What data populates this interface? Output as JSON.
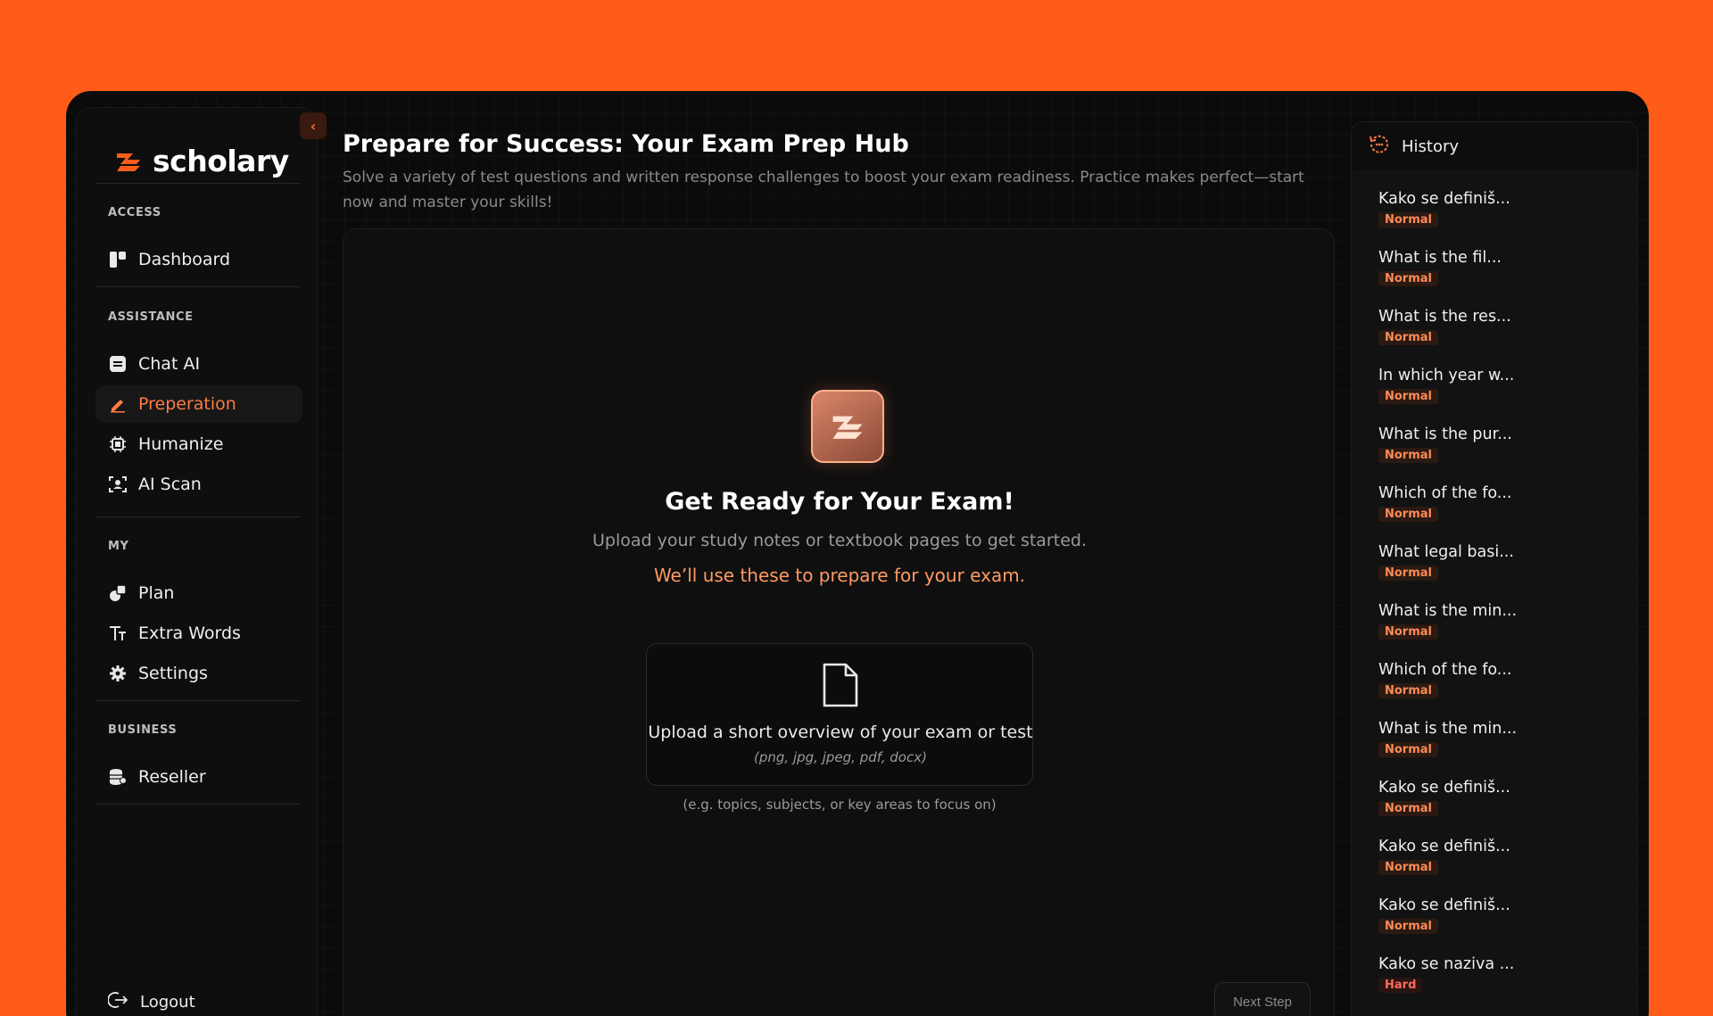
{
  "app": {
    "name": "scholary",
    "collapse_icon": "chevron-left-icon",
    "accent": "#FF5C1A"
  },
  "sidebar": {
    "sections": [
      {
        "label": "ACCESS",
        "items": [
          {
            "label": "Dashboard",
            "icon": "dashboard-icon"
          }
        ]
      },
      {
        "label": "ASSISTANCE",
        "items": [
          {
            "label": "Chat AI",
            "icon": "chat-icon"
          },
          {
            "label": "Preperation",
            "icon": "pencil-icon",
            "active": true
          },
          {
            "label": "Humanize",
            "icon": "chip-icon"
          },
          {
            "label": "AI Scan",
            "icon": "scan-icon"
          }
        ]
      },
      {
        "label": "MY",
        "items": [
          {
            "label": "Plan",
            "icon": "plan-icon"
          },
          {
            "label": "Extra Words",
            "icon": "text-icon"
          },
          {
            "label": "Settings",
            "icon": "gear-icon"
          }
        ]
      },
      {
        "label": "BUSINESS",
        "items": [
          {
            "label": "Reseller",
            "icon": "coins-icon"
          }
        ]
      }
    ],
    "logout_label": "Logout"
  },
  "main": {
    "title": "Prepare for Success: Your Exam Prep Hub",
    "subtitle": "Solve a variety of test questions and written response challenges to boost your exam readiness. Practice makes perfect—start now and master your skills!",
    "heading": "Get Ready for Your Exam!",
    "upload_subtitle": "Upload your study notes or textbook pages to get started.",
    "upload_note": "We’ll use these to prepare for your exam.",
    "dropzone_text": "Upload a short overview of your exam or test",
    "dropzone_types": "(png, jpg, jpeg, pdf, docx)",
    "dropzone_hint": "(e.g. topics, subjects, or key areas to focus on)",
    "next_label": "Next Step"
  },
  "history": {
    "title": "History",
    "items": [
      {
        "q": "Kako se definiš...",
        "tag": "Normal"
      },
      {
        "q": "What is the fil...",
        "tag": "Normal"
      },
      {
        "q": "What is the res...",
        "tag": "Normal"
      },
      {
        "q": "In which year w...",
        "tag": "Normal"
      },
      {
        "q": "What is the pur...",
        "tag": "Normal"
      },
      {
        "q": "Which of the fo...",
        "tag": "Normal"
      },
      {
        "q": "What legal basi...",
        "tag": "Normal"
      },
      {
        "q": "What is the min...",
        "tag": "Normal"
      },
      {
        "q": "Which of the fo...",
        "tag": "Normal"
      },
      {
        "q": "What is the min...",
        "tag": "Normal"
      },
      {
        "q": "Kako se definiš...",
        "tag": "Normal"
      },
      {
        "q": "Kako se definiš...",
        "tag": "Normal"
      },
      {
        "q": "Kako se definiš...",
        "tag": "Normal"
      },
      {
        "q": "Kako se naziva ...",
        "tag": "Hard"
      }
    ]
  }
}
